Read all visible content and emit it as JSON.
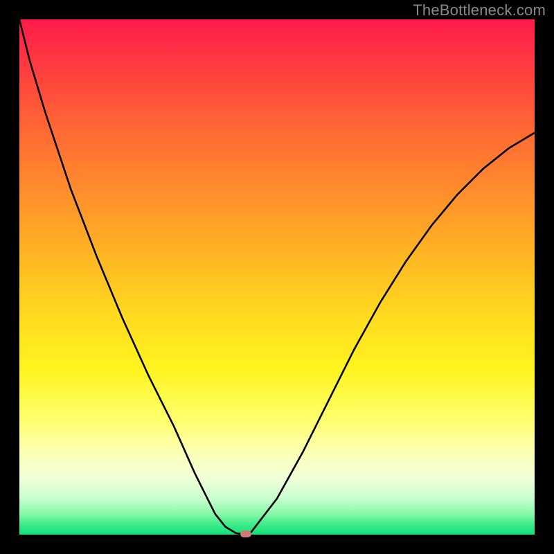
{
  "watermark": "TheBottleneck.com",
  "chart_data": {
    "type": "line",
    "title": "",
    "xlabel": "",
    "ylabel": "",
    "x": [
      0,
      2,
      5,
      10,
      15,
      20,
      25,
      30,
      34,
      36,
      38,
      40,
      42,
      44,
      45,
      50,
      55,
      60,
      65,
      70,
      75,
      80,
      85,
      90,
      95,
      100
    ],
    "values": [
      100,
      92,
      82,
      67,
      54,
      42,
      31,
      21,
      12,
      8,
      4,
      1.5,
      0.3,
      0,
      0.5,
      7,
      16,
      26,
      36,
      45,
      53,
      60,
      66,
      71,
      75,
      78
    ],
    "xlim": [
      0,
      100
    ],
    "ylim": [
      0,
      100
    ],
    "minimum_marker": {
      "x": 44,
      "y": 0
    },
    "background_gradient": [
      "#ff1a4b",
      "#ffff70",
      "#12e07a"
    ]
  }
}
